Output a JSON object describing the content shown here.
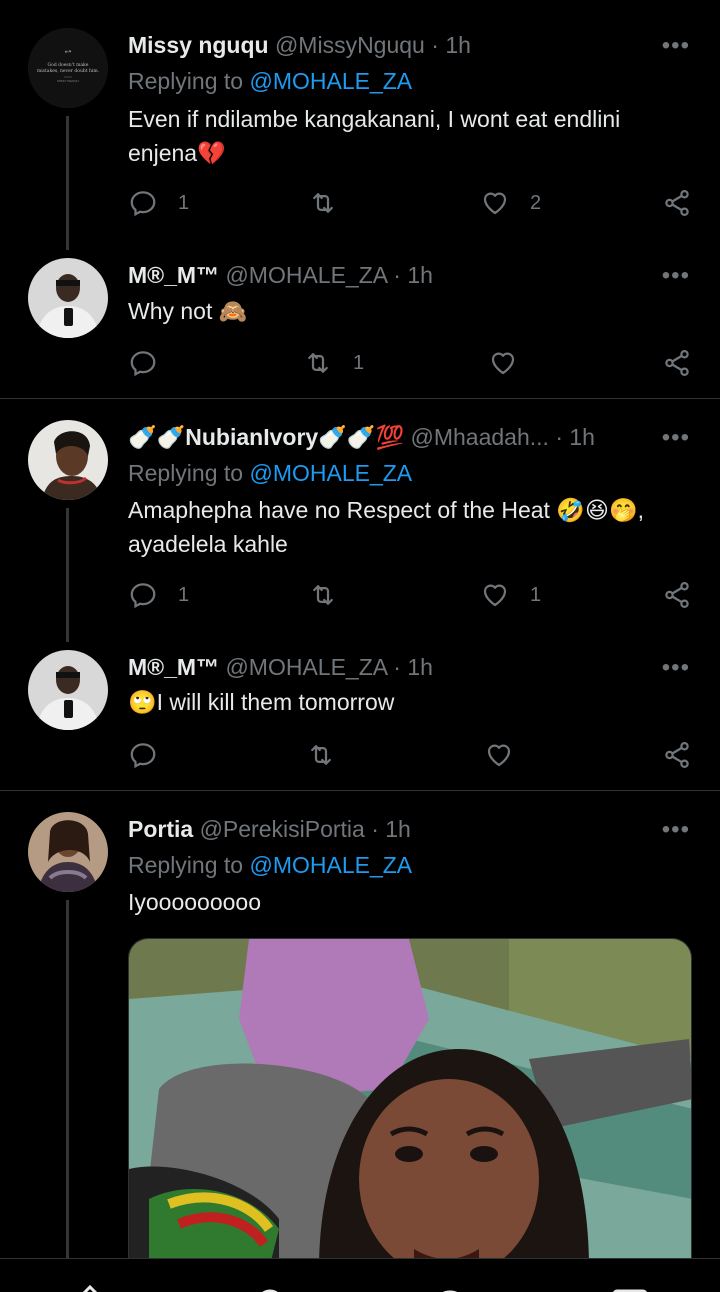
{
  "tweets": [
    {
      "name": "Missy nguqu",
      "handle": "@MissyNguqu",
      "time": "1h",
      "replying_label": "Replying to ",
      "replying_to": "@MOHALE_ZA",
      "text": "Even if ndilambe kangakanani, I wont eat endlini enjena💔",
      "avatar_text": "God doesn't make mistakes, never doubt him.",
      "replies": "1",
      "retweets": "",
      "likes": "2"
    },
    {
      "name": "M®_M™",
      "handle": "@MOHALE_ZA",
      "time": "1h",
      "text": "Why not 🙈",
      "replies": "",
      "retweets": "1",
      "likes": ""
    },
    {
      "name": "🍼🍼NubianIvory🍼🍼💯",
      "handle": "@Mhaadah...",
      "time": "1h",
      "replying_label": "Replying to ",
      "replying_to": "@MOHALE_ZA",
      "text": "Amaphepha have no Respect of the Heat 🤣😆🤭, ayadelela kahle",
      "replies": "1",
      "retweets": "",
      "likes": "1"
    },
    {
      "name": "M®_M™",
      "handle": "@MOHALE_ZA",
      "time": "1h",
      "text": "🙄I will kill them tomorrow",
      "replies": "",
      "retweets": "",
      "likes": ""
    },
    {
      "name": "Portia",
      "handle": "@PerekisiPortia",
      "time": "1h",
      "replying_label": "Replying to ",
      "replying_to": "@MOHALE_ZA",
      "text": "Iyooooooooo"
    }
  ],
  "dot": "·",
  "more": "•••",
  "icons": [
    "reply-icon",
    "retweet-icon",
    "like-icon",
    "share-icon",
    "more-icon",
    "home-icon",
    "search-icon",
    "notifications-icon",
    "messages-icon"
  ],
  "colors": {
    "background": "#000000",
    "text": "#e7e9ea",
    "muted": "#71767b",
    "accent": "#1d9bf0",
    "divider": "#2f3336"
  }
}
